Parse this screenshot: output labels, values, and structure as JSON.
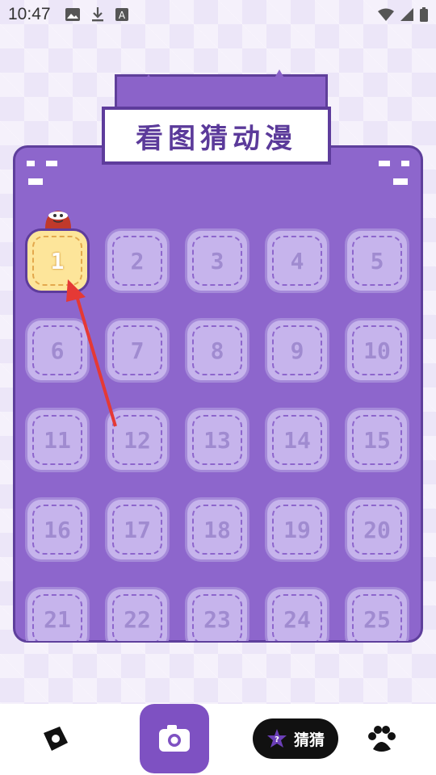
{
  "status": {
    "time": "10:47"
  },
  "title": "看图猜动漫",
  "levels": [
    "1",
    "2",
    "3",
    "4",
    "5",
    "6",
    "7",
    "8",
    "9",
    "10",
    "11",
    "12",
    "13",
    "14",
    "15",
    "16",
    "17",
    "18",
    "19",
    "20",
    "21",
    "22",
    "23",
    "24",
    "25"
  ],
  "bottom_nav": {
    "guess_label": "猜猜"
  },
  "colors": {
    "accent": "#8d66cc",
    "dark_accent": "#5e3c9c",
    "active_level": "#fde59a",
    "arrow": "#e53935"
  }
}
